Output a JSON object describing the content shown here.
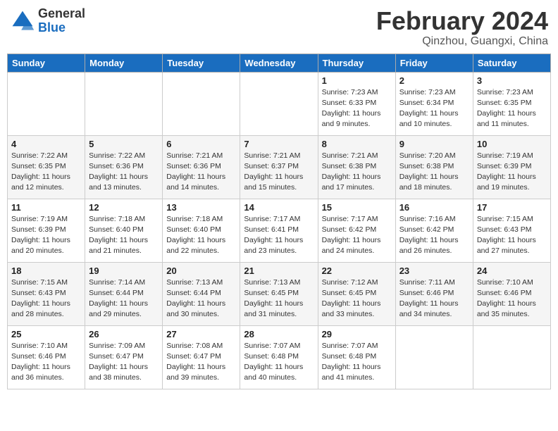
{
  "logo": {
    "general": "General",
    "blue": "Blue"
  },
  "title": {
    "month_year": "February 2024",
    "location": "Qinzhou, Guangxi, China"
  },
  "days_of_week": [
    "Sunday",
    "Monday",
    "Tuesday",
    "Wednesday",
    "Thursday",
    "Friday",
    "Saturday"
  ],
  "weeks": [
    [
      {
        "day": "",
        "sunrise": "",
        "sunset": "",
        "daylight": ""
      },
      {
        "day": "",
        "sunrise": "",
        "sunset": "",
        "daylight": ""
      },
      {
        "day": "",
        "sunrise": "",
        "sunset": "",
        "daylight": ""
      },
      {
        "day": "",
        "sunrise": "",
        "sunset": "",
        "daylight": ""
      },
      {
        "day": "1",
        "sunrise": "Sunrise: 7:23 AM",
        "sunset": "Sunset: 6:33 PM",
        "daylight": "Daylight: 11 hours and 9 minutes."
      },
      {
        "day": "2",
        "sunrise": "Sunrise: 7:23 AM",
        "sunset": "Sunset: 6:34 PM",
        "daylight": "Daylight: 11 hours and 10 minutes."
      },
      {
        "day": "3",
        "sunrise": "Sunrise: 7:23 AM",
        "sunset": "Sunset: 6:35 PM",
        "daylight": "Daylight: 11 hours and 11 minutes."
      }
    ],
    [
      {
        "day": "4",
        "sunrise": "Sunrise: 7:22 AM",
        "sunset": "Sunset: 6:35 PM",
        "daylight": "Daylight: 11 hours and 12 minutes."
      },
      {
        "day": "5",
        "sunrise": "Sunrise: 7:22 AM",
        "sunset": "Sunset: 6:36 PM",
        "daylight": "Daylight: 11 hours and 13 minutes."
      },
      {
        "day": "6",
        "sunrise": "Sunrise: 7:21 AM",
        "sunset": "Sunset: 6:36 PM",
        "daylight": "Daylight: 11 hours and 14 minutes."
      },
      {
        "day": "7",
        "sunrise": "Sunrise: 7:21 AM",
        "sunset": "Sunset: 6:37 PM",
        "daylight": "Daylight: 11 hours and 15 minutes."
      },
      {
        "day": "8",
        "sunrise": "Sunrise: 7:21 AM",
        "sunset": "Sunset: 6:38 PM",
        "daylight": "Daylight: 11 hours and 17 minutes."
      },
      {
        "day": "9",
        "sunrise": "Sunrise: 7:20 AM",
        "sunset": "Sunset: 6:38 PM",
        "daylight": "Daylight: 11 hours and 18 minutes."
      },
      {
        "day": "10",
        "sunrise": "Sunrise: 7:19 AM",
        "sunset": "Sunset: 6:39 PM",
        "daylight": "Daylight: 11 hours and 19 minutes."
      }
    ],
    [
      {
        "day": "11",
        "sunrise": "Sunrise: 7:19 AM",
        "sunset": "Sunset: 6:39 PM",
        "daylight": "Daylight: 11 hours and 20 minutes."
      },
      {
        "day": "12",
        "sunrise": "Sunrise: 7:18 AM",
        "sunset": "Sunset: 6:40 PM",
        "daylight": "Daylight: 11 hours and 21 minutes."
      },
      {
        "day": "13",
        "sunrise": "Sunrise: 7:18 AM",
        "sunset": "Sunset: 6:40 PM",
        "daylight": "Daylight: 11 hours and 22 minutes."
      },
      {
        "day": "14",
        "sunrise": "Sunrise: 7:17 AM",
        "sunset": "Sunset: 6:41 PM",
        "daylight": "Daylight: 11 hours and 23 minutes."
      },
      {
        "day": "15",
        "sunrise": "Sunrise: 7:17 AM",
        "sunset": "Sunset: 6:42 PM",
        "daylight": "Daylight: 11 hours and 24 minutes."
      },
      {
        "day": "16",
        "sunrise": "Sunrise: 7:16 AM",
        "sunset": "Sunset: 6:42 PM",
        "daylight": "Daylight: 11 hours and 26 minutes."
      },
      {
        "day": "17",
        "sunrise": "Sunrise: 7:15 AM",
        "sunset": "Sunset: 6:43 PM",
        "daylight": "Daylight: 11 hours and 27 minutes."
      }
    ],
    [
      {
        "day": "18",
        "sunrise": "Sunrise: 7:15 AM",
        "sunset": "Sunset: 6:43 PM",
        "daylight": "Daylight: 11 hours and 28 minutes."
      },
      {
        "day": "19",
        "sunrise": "Sunrise: 7:14 AM",
        "sunset": "Sunset: 6:44 PM",
        "daylight": "Daylight: 11 hours and 29 minutes."
      },
      {
        "day": "20",
        "sunrise": "Sunrise: 7:13 AM",
        "sunset": "Sunset: 6:44 PM",
        "daylight": "Daylight: 11 hours and 30 minutes."
      },
      {
        "day": "21",
        "sunrise": "Sunrise: 7:13 AM",
        "sunset": "Sunset: 6:45 PM",
        "daylight": "Daylight: 11 hours and 31 minutes."
      },
      {
        "day": "22",
        "sunrise": "Sunrise: 7:12 AM",
        "sunset": "Sunset: 6:45 PM",
        "daylight": "Daylight: 11 hours and 33 minutes."
      },
      {
        "day": "23",
        "sunrise": "Sunrise: 7:11 AM",
        "sunset": "Sunset: 6:46 PM",
        "daylight": "Daylight: 11 hours and 34 minutes."
      },
      {
        "day": "24",
        "sunrise": "Sunrise: 7:10 AM",
        "sunset": "Sunset: 6:46 PM",
        "daylight": "Daylight: 11 hours and 35 minutes."
      }
    ],
    [
      {
        "day": "25",
        "sunrise": "Sunrise: 7:10 AM",
        "sunset": "Sunset: 6:46 PM",
        "daylight": "Daylight: 11 hours and 36 minutes."
      },
      {
        "day": "26",
        "sunrise": "Sunrise: 7:09 AM",
        "sunset": "Sunset: 6:47 PM",
        "daylight": "Daylight: 11 hours and 38 minutes."
      },
      {
        "day": "27",
        "sunrise": "Sunrise: 7:08 AM",
        "sunset": "Sunset: 6:47 PM",
        "daylight": "Daylight: 11 hours and 39 minutes."
      },
      {
        "day": "28",
        "sunrise": "Sunrise: 7:07 AM",
        "sunset": "Sunset: 6:48 PM",
        "daylight": "Daylight: 11 hours and 40 minutes."
      },
      {
        "day": "29",
        "sunrise": "Sunrise: 7:07 AM",
        "sunset": "Sunset: 6:48 PM",
        "daylight": "Daylight: 11 hours and 41 minutes."
      },
      {
        "day": "",
        "sunrise": "",
        "sunset": "",
        "daylight": ""
      },
      {
        "day": "",
        "sunrise": "",
        "sunset": "",
        "daylight": ""
      }
    ]
  ]
}
